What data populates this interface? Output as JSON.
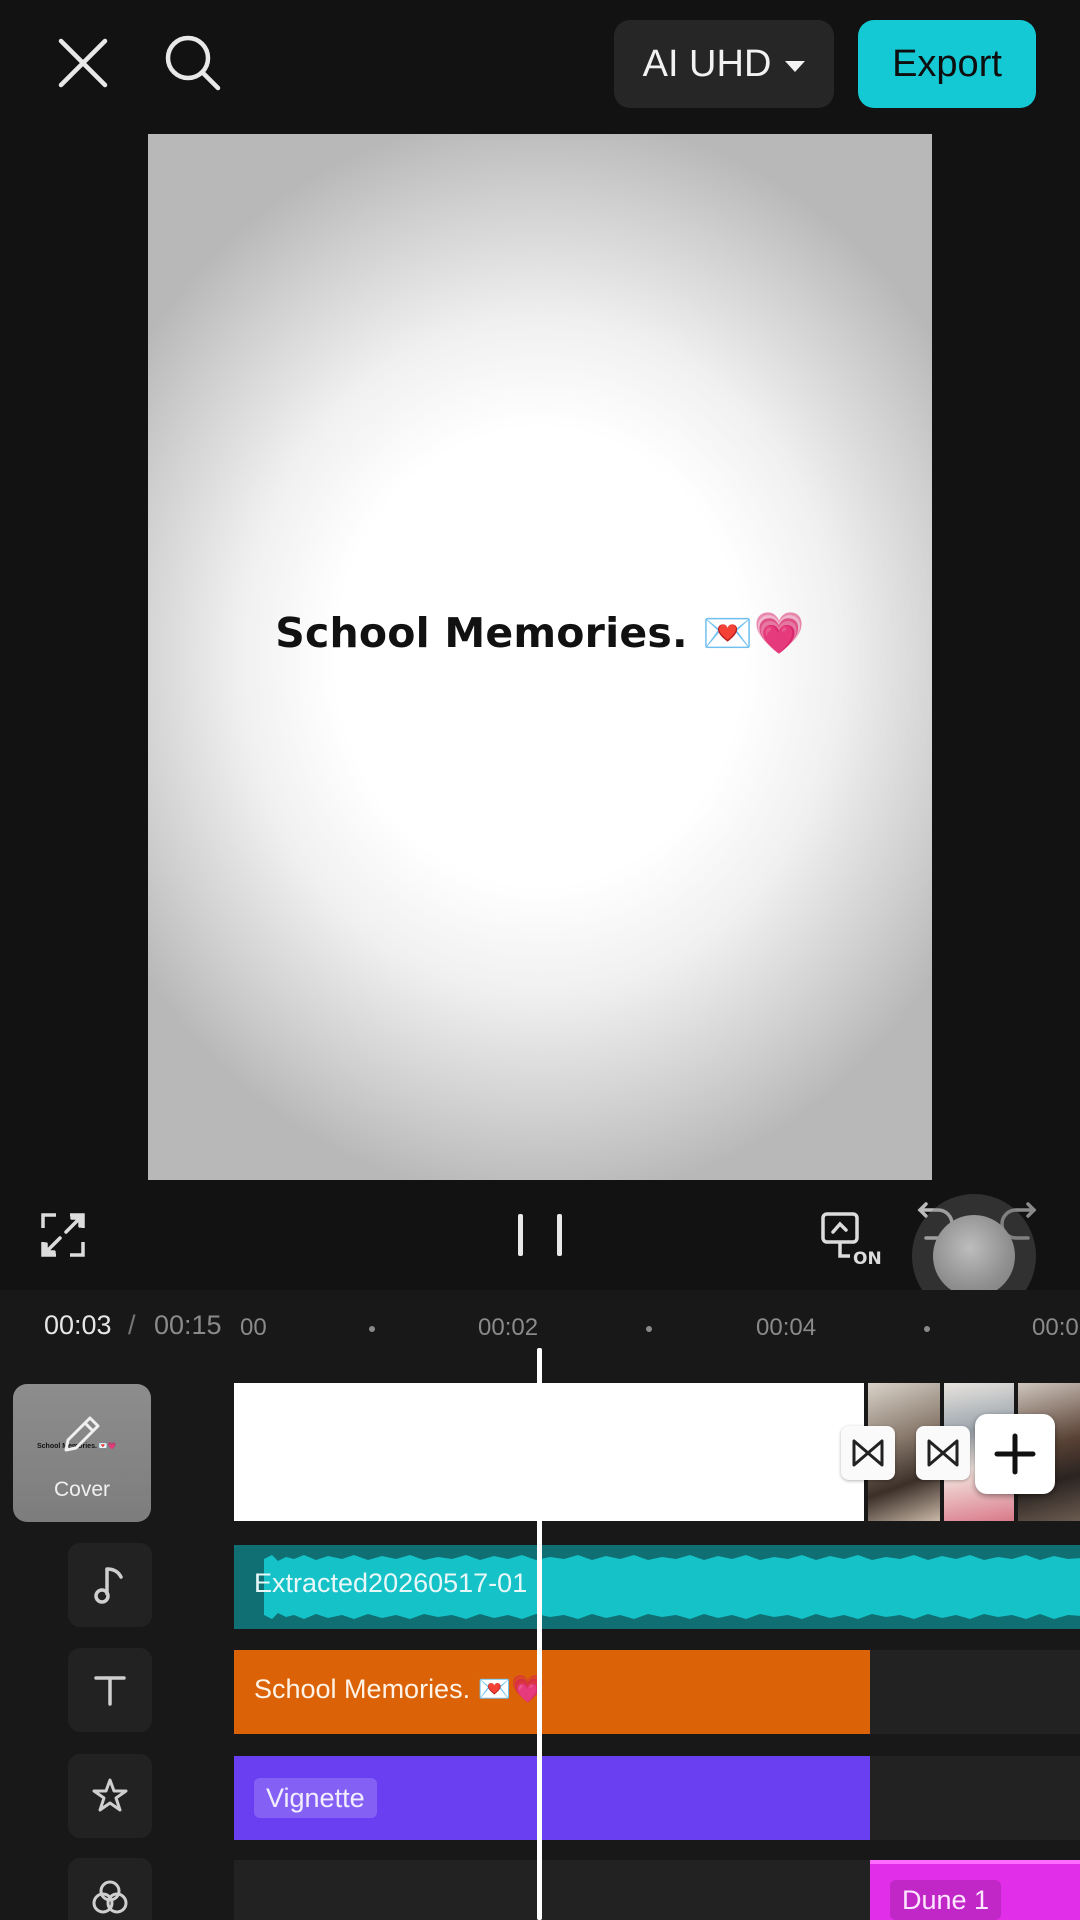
{
  "topbar": {
    "quality_label": "AI UHD",
    "export_label": "Export"
  },
  "preview": {
    "text": "School Memories. 💌💗"
  },
  "controls": {
    "captions_badge": "ON"
  },
  "timeline": {
    "current_time": "00:03",
    "separator": "/",
    "total_time": "00:15",
    "ruler": [
      "00",
      "00:02",
      "00:04",
      "00:0"
    ],
    "cover_label": "Cover",
    "audio_clip": "Extracted20260517-01",
    "text_clip": "School Memories. 💌💗",
    "effect_clip": "Vignette",
    "filter_clip": "Dune 1"
  },
  "colors": {
    "accent": "#14c8d4",
    "audio_track": "#0f6f73",
    "audio_wave": "#14c2c8",
    "text_track": "#db6206",
    "effect_track": "#6a3ff2",
    "filter_track": "#e12ee8"
  }
}
